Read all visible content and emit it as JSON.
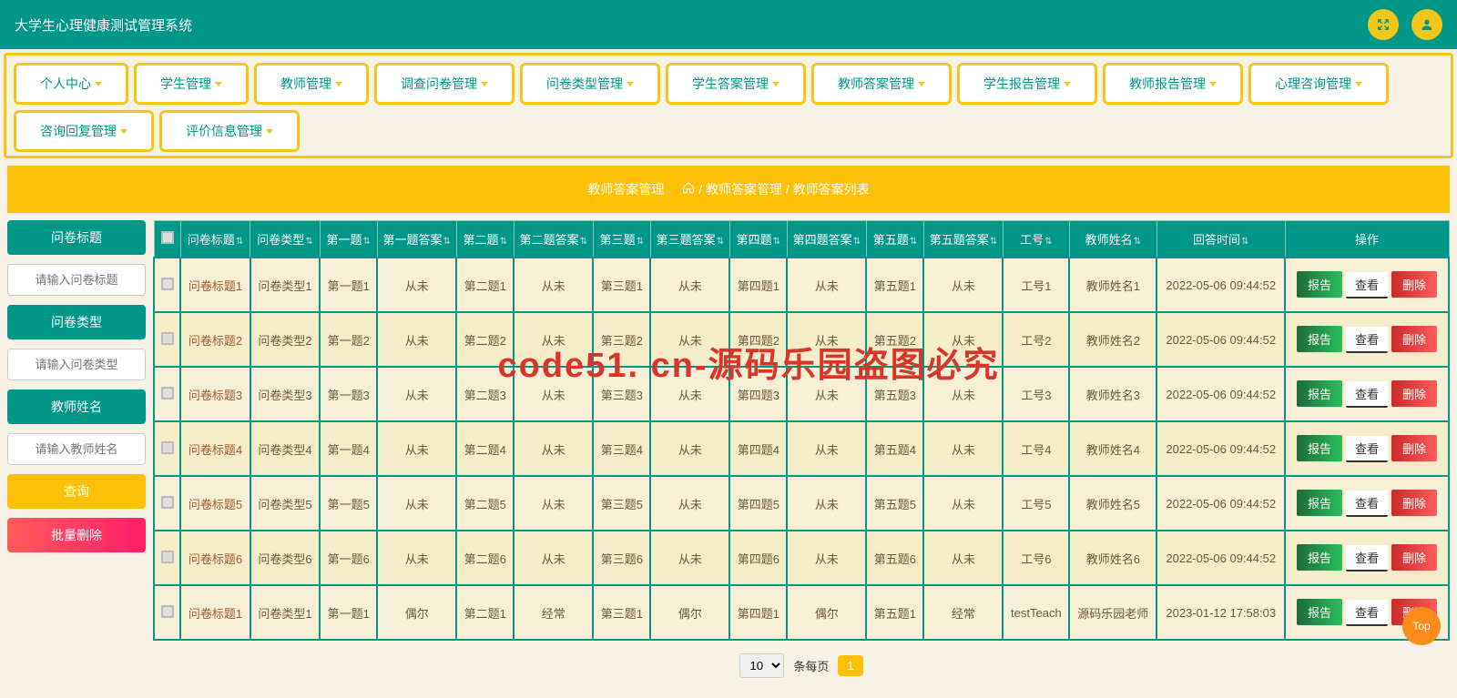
{
  "header": {
    "title": "大学生心理健康测试管理系统"
  },
  "nav": [
    "个人中心",
    "学生管理",
    "教师管理",
    "调查问卷管理",
    "问卷类型管理",
    "学生答案管理",
    "教师答案管理",
    "学生报告管理",
    "教师报告管理",
    "心理咨询管理",
    "咨询回复管理",
    "评价信息管理"
  ],
  "breadcrumb": {
    "section": "教师答案管理",
    "path1": "教师答案管理",
    "path2": "教师答案列表"
  },
  "sidebar": {
    "label1": "问卷标题",
    "ph1": "请输入问卷标题",
    "label2": "问卷类型",
    "ph2": "请输入问卷类型",
    "label3": "教师姓名",
    "ph3": "请输入教师姓名",
    "query": "查询",
    "batch_delete": "批量删除"
  },
  "table": {
    "headers": [
      "问卷标题",
      "问卷类型",
      "第一题",
      "第一题答案",
      "第二题",
      "第二题答案",
      "第三题",
      "第三题答案",
      "第四题",
      "第四题答案",
      "第五题",
      "第五题答案",
      "工号",
      "教师姓名",
      "回答时间",
      "操作"
    ],
    "ops": {
      "report": "报告",
      "view": "查看",
      "del": "删除"
    },
    "rows": [
      [
        "问卷标题1",
        "问卷类型1",
        "第一题1",
        "从未",
        "第二题1",
        "从未",
        "第三题1",
        "从未",
        "第四题1",
        "从未",
        "第五题1",
        "从未",
        "工号1",
        "教师姓名1",
        "2022-05-06 09:44:52"
      ],
      [
        "问卷标题2",
        "问卷类型2",
        "第一题2",
        "从未",
        "第二题2",
        "从未",
        "第三题2",
        "从未",
        "第四题2",
        "从未",
        "第五题2",
        "从未",
        "工号2",
        "教师姓名2",
        "2022-05-06 09:44:52"
      ],
      [
        "问卷标题3",
        "问卷类型3",
        "第一题3",
        "从未",
        "第二题3",
        "从未",
        "第三题3",
        "从未",
        "第四题3",
        "从未",
        "第五题3",
        "从未",
        "工号3",
        "教师姓名3",
        "2022-05-06 09:44:52"
      ],
      [
        "问卷标题4",
        "问卷类型4",
        "第一题4",
        "从未",
        "第二题4",
        "从未",
        "第三题4",
        "从未",
        "第四题4",
        "从未",
        "第五题4",
        "从未",
        "工号4",
        "教师姓名4",
        "2022-05-06 09:44:52"
      ],
      [
        "问卷标题5",
        "问卷类型5",
        "第一题5",
        "从未",
        "第二题5",
        "从未",
        "第三题5",
        "从未",
        "第四题5",
        "从未",
        "第五题5",
        "从未",
        "工号5",
        "教师姓名5",
        "2022-05-06 09:44:52"
      ],
      [
        "问卷标题6",
        "问卷类型6",
        "第一题6",
        "从未",
        "第二题6",
        "从未",
        "第三题6",
        "从未",
        "第四题6",
        "从未",
        "第五题6",
        "从未",
        "工号6",
        "教师姓名6",
        "2022-05-06 09:44:52"
      ],
      [
        "问卷标题1",
        "问卷类型1",
        "第一题1",
        "偶尔",
        "第二题1",
        "经常",
        "第三题1",
        "偶尔",
        "第四题1",
        "偶尔",
        "第五题1",
        "经常",
        "testTeach",
        "源码乐园老师",
        "2023-01-12 17:58:03"
      ]
    ]
  },
  "pagination": {
    "size": "10",
    "per_page_label": "条每页",
    "current": "1"
  },
  "top_btn": "Top",
  "watermark": "code51. cn-源码乐园盗图必究"
}
